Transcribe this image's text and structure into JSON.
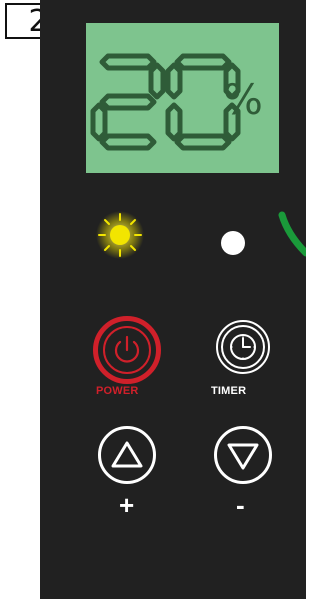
{
  "panel_number": "2",
  "display": {
    "value": "20",
    "unit": "%"
  },
  "indicators": {
    "left_led": "sun-icon",
    "right_led": "white-dot"
  },
  "buttons": {
    "power_label": "POWER",
    "timer_label": "TIMER",
    "plus_label": "+",
    "minus_label": "-"
  },
  "colors": {
    "panel": "#212121",
    "lcd_background": "#7ec48e",
    "lcd_segments": "#2f5c38",
    "power_red": "#d0202a",
    "led_yellow": "#f2e500",
    "accent_green": "#1a9a3a"
  }
}
